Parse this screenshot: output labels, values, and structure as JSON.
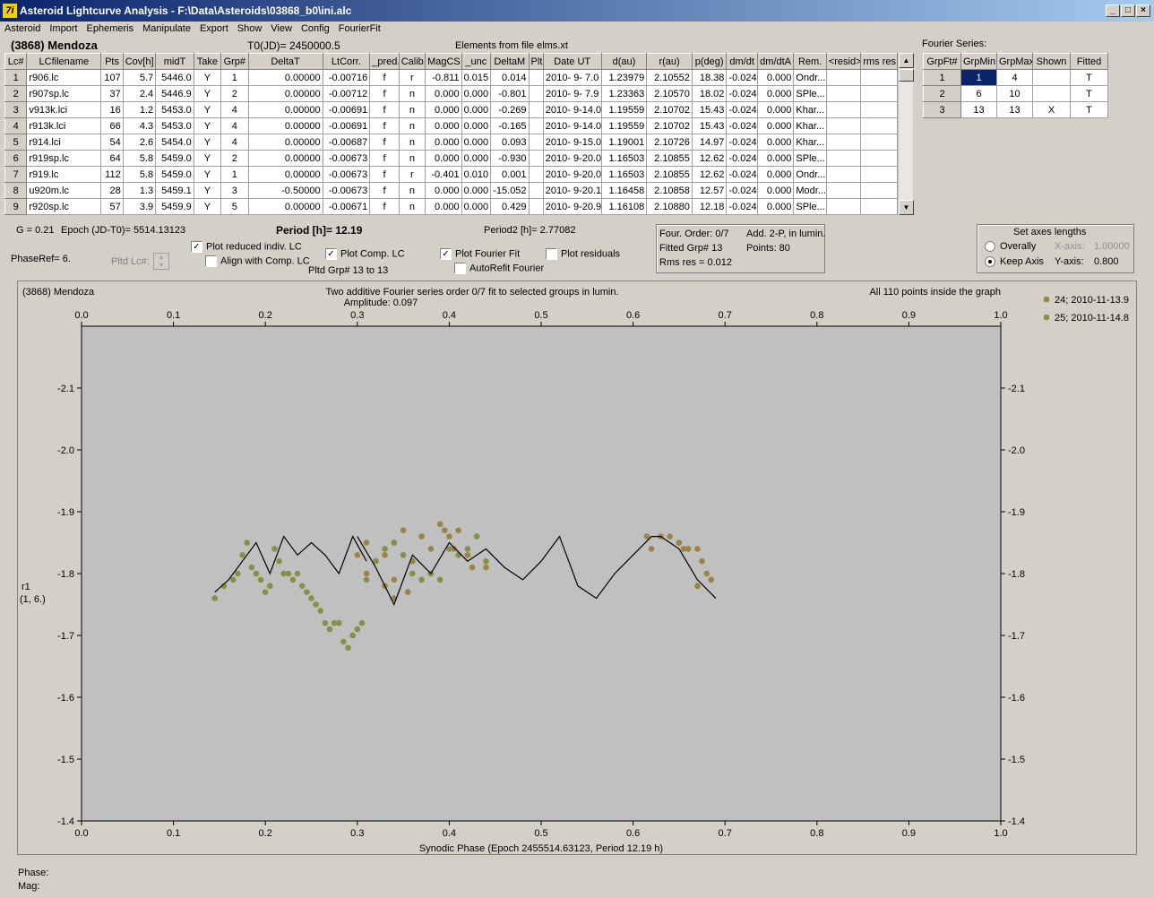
{
  "window": {
    "title": "Asteroid Lightcurve Analysis - F:\\Data\\Asteroids\\03868_b0\\ini.alc",
    "icon_text": "7i"
  },
  "menu": [
    "Asteroid",
    "Import",
    "Ephemeris",
    "Manipulate",
    "Export",
    "Show",
    "View",
    "Config",
    "FourierFit"
  ],
  "header": {
    "asteroid": "(3868) Mendoza",
    "t0": "T0(JD)= 2450000.5",
    "elements": "Elements from file elms.xt",
    "fourier_series_label": "Fourier Series:"
  },
  "lc_table": {
    "columns": [
      "Lc#",
      "LCfilename",
      "Pts",
      "Cov[h]",
      "midT",
      "Take",
      "Grp#",
      "DeltaT",
      "LtCorr.",
      "_pred.",
      "Calib.",
      "MagCS",
      "_unc",
      "DeltaM",
      "Plt",
      "Date UT",
      "d(au)",
      "r(au)",
      "p(deg)",
      "dm/dt",
      "dm/dtA",
      "Rem.",
      "<resid>",
      "rms res"
    ],
    "rows": [
      [
        "1",
        "r906.lc",
        "107",
        "5.7",
        "5446.0",
        "Y",
        "1",
        "0.00000",
        "-0.00716",
        "f",
        "r",
        "-0.811",
        "0.015",
        "0.014",
        "",
        "2010- 9- 7.0",
        "1.23979",
        "2.10552",
        "18.38",
        "-0.024",
        "0.000",
        "Ondr...",
        "",
        ""
      ],
      [
        "2",
        "r907sp.lc",
        "37",
        "2.4",
        "5446.9",
        "Y",
        "2",
        "0.00000",
        "-0.00712",
        "f",
        "n",
        "0.000",
        "0.000",
        "-0.801",
        "",
        "2010- 9- 7.9",
        "1.23363",
        "2.10570",
        "18.02",
        "-0.024",
        "0.000",
        "SPle...",
        "",
        ""
      ],
      [
        "3",
        "v913k.lci",
        "16",
        "1.2",
        "5453.0",
        "Y",
        "4",
        "0.00000",
        "-0.00691",
        "f",
        "n",
        "0.000",
        "0.000",
        "-0.269",
        "",
        "2010- 9-14.0",
        "1.19559",
        "2.10702",
        "15.43",
        "-0.024",
        "0.000",
        "Khar...",
        "",
        ""
      ],
      [
        "4",
        "r913k.lci",
        "66",
        "4.3",
        "5453.0",
        "Y",
        "4",
        "0.00000",
        "-0.00691",
        "f",
        "n",
        "0.000",
        "0.000",
        "-0.165",
        "",
        "2010- 9-14.0",
        "1.19559",
        "2.10702",
        "15.43",
        "-0.024",
        "0.000",
        "Khar...",
        "",
        ""
      ],
      [
        "5",
        "r914.lci",
        "54",
        "2.6",
        "5454.0",
        "Y",
        "4",
        "0.00000",
        "-0.00687",
        "f",
        "n",
        "0.000",
        "0.000",
        "0.093",
        "",
        "2010- 9-15.0",
        "1.19001",
        "2.10726",
        "14.97",
        "-0.024",
        "0.000",
        "Khar...",
        "",
        ""
      ],
      [
        "6",
        "r919sp.lc",
        "64",
        "5.8",
        "5459.0",
        "Y",
        "2",
        "0.00000",
        "-0.00673",
        "f",
        "n",
        "0.000",
        "0.000",
        "-0.930",
        "",
        "2010- 9-20.0",
        "1.16503",
        "2.10855",
        "12.62",
        "-0.024",
        "0.000",
        "SPle...",
        "",
        ""
      ],
      [
        "7",
        "r919.lc",
        "112",
        "5.8",
        "5459.0",
        "Y",
        "1",
        "0.00000",
        "-0.00673",
        "f",
        "r",
        "-0.401",
        "0.010",
        "0.001",
        "",
        "2010- 9-20.0",
        "1.16503",
        "2.10855",
        "12.62",
        "-0.024",
        "0.000",
        "Ondr...",
        "",
        ""
      ],
      [
        "8",
        "u920m.lc",
        "28",
        "1.3",
        "5459.1",
        "Y",
        "3",
        "-0.50000",
        "-0.00673",
        "f",
        "n",
        "0.000",
        "0.000",
        "-15.052",
        "",
        "2010- 9-20.1",
        "1.16458",
        "2.10858",
        "12.57",
        "-0.024",
        "0.000",
        "Modr...",
        "",
        ""
      ],
      [
        "9",
        "r920sp.lc",
        "57",
        "3.9",
        "5459.9",
        "Y",
        "5",
        "0.00000",
        "-0.00671",
        "f",
        "n",
        "0.000",
        "0.000",
        "0.429",
        "",
        "2010- 9-20.9",
        "1.16108",
        "2.10880",
        "12.18",
        "-0.024",
        "0.000",
        "SPle...",
        "",
        ""
      ]
    ]
  },
  "fourier_table": {
    "columns": [
      "GrpFt#",
      "GrpMin",
      "GrpMax",
      "Shown",
      "Fitted"
    ],
    "rows": [
      [
        "1",
        "1",
        "4",
        "",
        "T"
      ],
      [
        "2",
        "6",
        "10",
        "",
        "T"
      ],
      [
        "3",
        "13",
        "13",
        "X",
        "T"
      ]
    ]
  },
  "controls": {
    "g": "G = 0.21",
    "epoch": "Epoch (JD-T0)= 5514.13123",
    "period": "Period [h]= 12.19",
    "period2": "Period2 [h]= 2.77082",
    "phaseref": "PhaseRef= 6.",
    "pltd_lc": "Pltd Lc#:",
    "plot_reduced": "Plot reduced indiv. LC",
    "align_comp": "Align with Comp. LC",
    "plot_comp": "Plot Comp. LC",
    "pltd_grp": "Pltd Grp#  13 to   13",
    "plot_fourier": "Plot Fourier Fit",
    "autorefit": "AutoRefit Fourier",
    "plot_residuals": "Plot residuals"
  },
  "fitinfo": {
    "order": "Four. Order:  0/7",
    "add": "Add. 2-P, in lumin.",
    "fitted": "Fitted Grp# 13",
    "points": "Points: 80",
    "rms": "Rms res     = 0.012"
  },
  "axes": {
    "title": "Set axes lengths",
    "overally": "Overally",
    "keep": "Keep Axis",
    "xlabel": "X-axis:",
    "xval": "1.00000",
    "ylabel": "Y-axis:",
    "yval": "0.800"
  },
  "plot": {
    "name": "(3868) Mendoza",
    "subtitle": "Two additive Fourier series order 0/7 fit to selected groups in lumin.",
    "amplitude": "Amplitude: 0.097",
    "points_note": "All 110 points inside the graph",
    "xaxis_title": "Synodic Phase (Epoch 2455514.63123, Period 12.19 h)",
    "ylabel1": "r1",
    "ylabel2": "(1, 6.)",
    "legend": [
      {
        "label": "24; 2010-11-13.9",
        "color": "#9b8446"
      },
      {
        "label": "25; 2010-11-14.8",
        "color": "#8a8f48"
      }
    ]
  },
  "chart_data": {
    "type": "scatter",
    "xlim": [
      0,
      1
    ],
    "ylim": [
      -2.2,
      -1.4
    ],
    "inverted_y": true,
    "xticks": [
      "0.0",
      "0.1",
      "0.2",
      "0.3",
      "0.4",
      "0.5",
      "0.6",
      "0.7",
      "0.8",
      "0.9",
      "1.0"
    ],
    "yticks": [
      "-2.1",
      "-2.0",
      "-1.9",
      "-1.8",
      "-1.7",
      "-1.6",
      "-1.5",
      "-1.4"
    ],
    "series": [
      {
        "name": "24; 2010-11-13.9",
        "color": "#9b8446",
        "marker": "dot",
        "x": [
          0.3,
          0.31,
          0.32,
          0.33,
          0.33,
          0.34,
          0.34,
          0.35,
          0.36,
          0.37,
          0.38,
          0.39,
          0.395,
          0.4,
          0.41,
          0.42,
          0.43,
          0.44,
          0.62,
          0.63,
          0.64,
          0.65,
          0.66,
          0.67,
          0.675,
          0.68,
          0.685,
          0.31,
          0.34,
          0.355,
          0.38,
          0.405,
          0.425,
          0.615,
          0.655,
          0.67
        ],
        "y": [
          -1.83,
          -1.85,
          -1.82,
          -1.78,
          -1.83,
          -1.85,
          -1.79,
          -1.87,
          -1.82,
          -1.86,
          -1.84,
          -1.88,
          -1.87,
          -1.86,
          -1.87,
          -1.83,
          -1.86,
          -1.81,
          -1.84,
          -1.86,
          -1.86,
          -1.85,
          -1.84,
          -1.84,
          -1.82,
          -1.8,
          -1.79,
          -1.8,
          -1.76,
          -1.77,
          -1.8,
          -1.84,
          -1.81,
          -1.86,
          -1.84,
          -1.78
        ]
      },
      {
        "name": "25; 2010-11-14.8",
        "color": "#8a8f48",
        "marker": "dot",
        "x": [
          0.145,
          0.155,
          0.165,
          0.17,
          0.175,
          0.18,
          0.185,
          0.19,
          0.195,
          0.2,
          0.205,
          0.21,
          0.215,
          0.22,
          0.225,
          0.23,
          0.235,
          0.24,
          0.245,
          0.25,
          0.255,
          0.26,
          0.265,
          0.27,
          0.275,
          0.28,
          0.285,
          0.29,
          0.295,
          0.3,
          0.305,
          0.31,
          0.32,
          0.33,
          0.34,
          0.35,
          0.36,
          0.37,
          0.38,
          0.39,
          0.4,
          0.41,
          0.42,
          0.43,
          0.44
        ],
        "y": [
          -1.76,
          -1.78,
          -1.79,
          -1.8,
          -1.83,
          -1.85,
          -1.81,
          -1.8,
          -1.79,
          -1.77,
          -1.78,
          -1.84,
          -1.82,
          -1.8,
          -1.8,
          -1.79,
          -1.8,
          -1.78,
          -1.77,
          -1.76,
          -1.75,
          -1.74,
          -1.72,
          -1.71,
          -1.72,
          -1.72,
          -1.69,
          -1.68,
          -1.7,
          -1.71,
          -1.72,
          -1.79,
          -1.82,
          -1.84,
          -1.85,
          -1.83,
          -1.8,
          -1.79,
          -1.8,
          -1.79,
          -1.84,
          -1.83,
          -1.84,
          -1.86,
          -1.82
        ]
      },
      {
        "name": "fit",
        "color": "#000000",
        "marker": "line",
        "x": [
          0.145,
          0.16,
          0.175,
          0.19,
          0.205,
          0.22,
          0.235,
          0.25,
          0.265,
          0.28,
          0.295,
          0.31
        ],
        "y": [
          -1.77,
          -1.79,
          -1.82,
          -1.85,
          -1.8,
          -1.86,
          -1.83,
          -1.85,
          -1.83,
          -1.8,
          -1.86,
          -1.82
        ]
      },
      {
        "name": "fit2",
        "color": "#000000",
        "marker": "line",
        "x": [
          0.3,
          0.32,
          0.34,
          0.36,
          0.38,
          0.4,
          0.42,
          0.44,
          0.46,
          0.48,
          0.5,
          0.52,
          0.54,
          0.56,
          0.58,
          0.6,
          0.62,
          0.63,
          0.65,
          0.67,
          0.69
        ],
        "y": [
          -1.86,
          -1.81,
          -1.75,
          -1.83,
          -1.8,
          -1.85,
          -1.82,
          -1.84,
          -1.81,
          -1.79,
          -1.82,
          -1.86,
          -1.78,
          -1.76,
          -1.8,
          -1.83,
          -1.86,
          -1.86,
          -1.84,
          -1.79,
          -1.76
        ]
      }
    ]
  },
  "status": {
    "phase": "Phase:",
    "mag": "Mag:"
  }
}
